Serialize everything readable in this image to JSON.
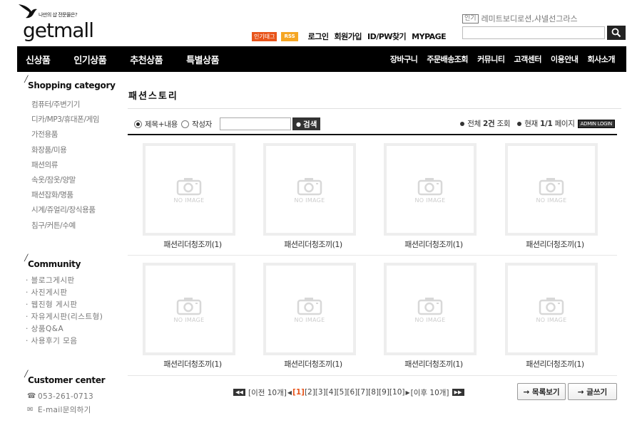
{
  "header": {
    "tagline": "나만의 샵 전문몰은?",
    "brand": "getmall",
    "badges": {
      "tag": "인기태그",
      "rss": "RSS"
    },
    "links": [
      "로그인",
      "회원가입",
      "ID/PW찾기",
      "MYPAGE"
    ],
    "popular_label": "인기",
    "popular_terms": "레미트보디로션,샤넬선그라스"
  },
  "nav": {
    "main": [
      "신상품",
      "인기상품",
      "추천상품",
      "특별상품"
    ],
    "sub": [
      "장바구니",
      "주문배송조회",
      "커뮤니티",
      "고객센터",
      "이용안내",
      "회사소개"
    ]
  },
  "sidebar": {
    "category_title": "Shopping category",
    "categories": [
      "컴퓨터/주변기기",
      "디카/MP3/휴대폰/게임",
      "가전용품",
      "화장품/미용",
      "패션의류",
      "속옷/잠옷/양말",
      "패션잡화/명품",
      "시계/쥬얼리/장식용품",
      "침구/커튼/수예"
    ],
    "community_title": "Community",
    "community": [
      "· 블로그게시판",
      "· 사진게시판",
      "· 웹진형 게시판",
      "· 자유게시판(리스트형)",
      "· 상품Q&A",
      "· 사용후기 모음"
    ],
    "cs_title": "Customer center",
    "cs": {
      "phone": "053-261-0713",
      "email": "E-mail문의하기"
    }
  },
  "board": {
    "title": "패션스토리",
    "search": {
      "option_title_content": "제목+내용",
      "option_author": "작성자",
      "button": "검색"
    },
    "stats": {
      "total_prefix": "전체",
      "total": "2건",
      "total_suffix": "조회",
      "page_prefix": "현재",
      "page": "1/1",
      "page_suffix": "페이지",
      "admin": "ADMIN LOGIN"
    },
    "no_image_text": "NO IMAGE",
    "items": [
      "패션리더청조끼(1)",
      "패션리더청조끼(1)",
      "패션리더청조끼(1)",
      "패션리더청조끼(1)",
      "패션리더청조끼(1)",
      "패션리더청조끼(1)",
      "패션리더청조끼(1)",
      "패션리더청조끼(1)"
    ],
    "pager": {
      "prev": "[이전 10개]",
      "current": "[1]",
      "pages": "[2][3][4][5][6][7][8][9][10]",
      "next": "[이후 10개]"
    },
    "buttons": {
      "list": "→ 목록보기",
      "write": "→ 글쓰기"
    }
  }
}
